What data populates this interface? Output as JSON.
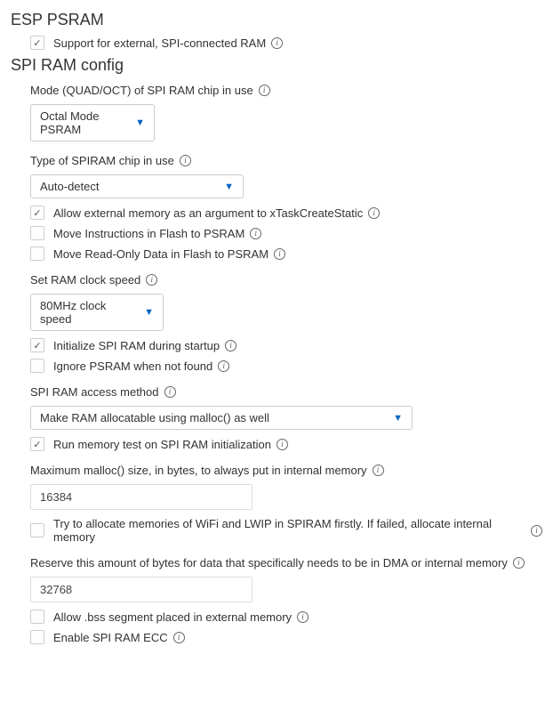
{
  "section1": {
    "title": "ESP PSRAM",
    "cb1": {
      "label": "Support for external, SPI-connected RAM",
      "checked": true
    }
  },
  "section2": {
    "title": "SPI RAM config",
    "mode_label": "Mode (QUAD/OCT) of SPI RAM chip in use",
    "mode_value": "Octal Mode PSRAM",
    "type_label": "Type of SPIRAM chip in use",
    "type_value": "Auto-detect",
    "cb_allow_ext": {
      "label": "Allow external memory as an argument to xTaskCreateStatic",
      "checked": true
    },
    "cb_move_instr": {
      "label": "Move Instructions in Flash to PSRAM",
      "checked": false
    },
    "cb_move_ro": {
      "label": "Move Read-Only Data in Flash to PSRAM",
      "checked": false
    },
    "clock_label": "Set RAM clock speed",
    "clock_value": "80MHz clock speed",
    "cb_init": {
      "label": "Initialize SPI RAM during startup",
      "checked": true
    },
    "cb_ignore": {
      "label": "Ignore PSRAM when not found",
      "checked": false
    },
    "access_label": "SPI RAM access method",
    "access_value": "Make RAM allocatable using malloc() as well",
    "cb_memtest": {
      "label": "Run memory test on SPI RAM initialization",
      "checked": true
    },
    "max_malloc_label": "Maximum malloc() size, in bytes, to always put in internal memory",
    "max_malloc_value": "16384",
    "cb_wifi_lwip": {
      "label": "Try to allocate memories of WiFi and LWIP in SPIRAM firstly. If failed, allocate internal memory",
      "checked": false
    },
    "reserve_label": "Reserve this amount of bytes for data that specifically needs to be in DMA or internal memory",
    "reserve_value": "32768",
    "cb_bss": {
      "label": "Allow .bss segment placed in external memory",
      "checked": false
    },
    "cb_ecc": {
      "label": "Enable SPI RAM ECC",
      "checked": false
    }
  }
}
